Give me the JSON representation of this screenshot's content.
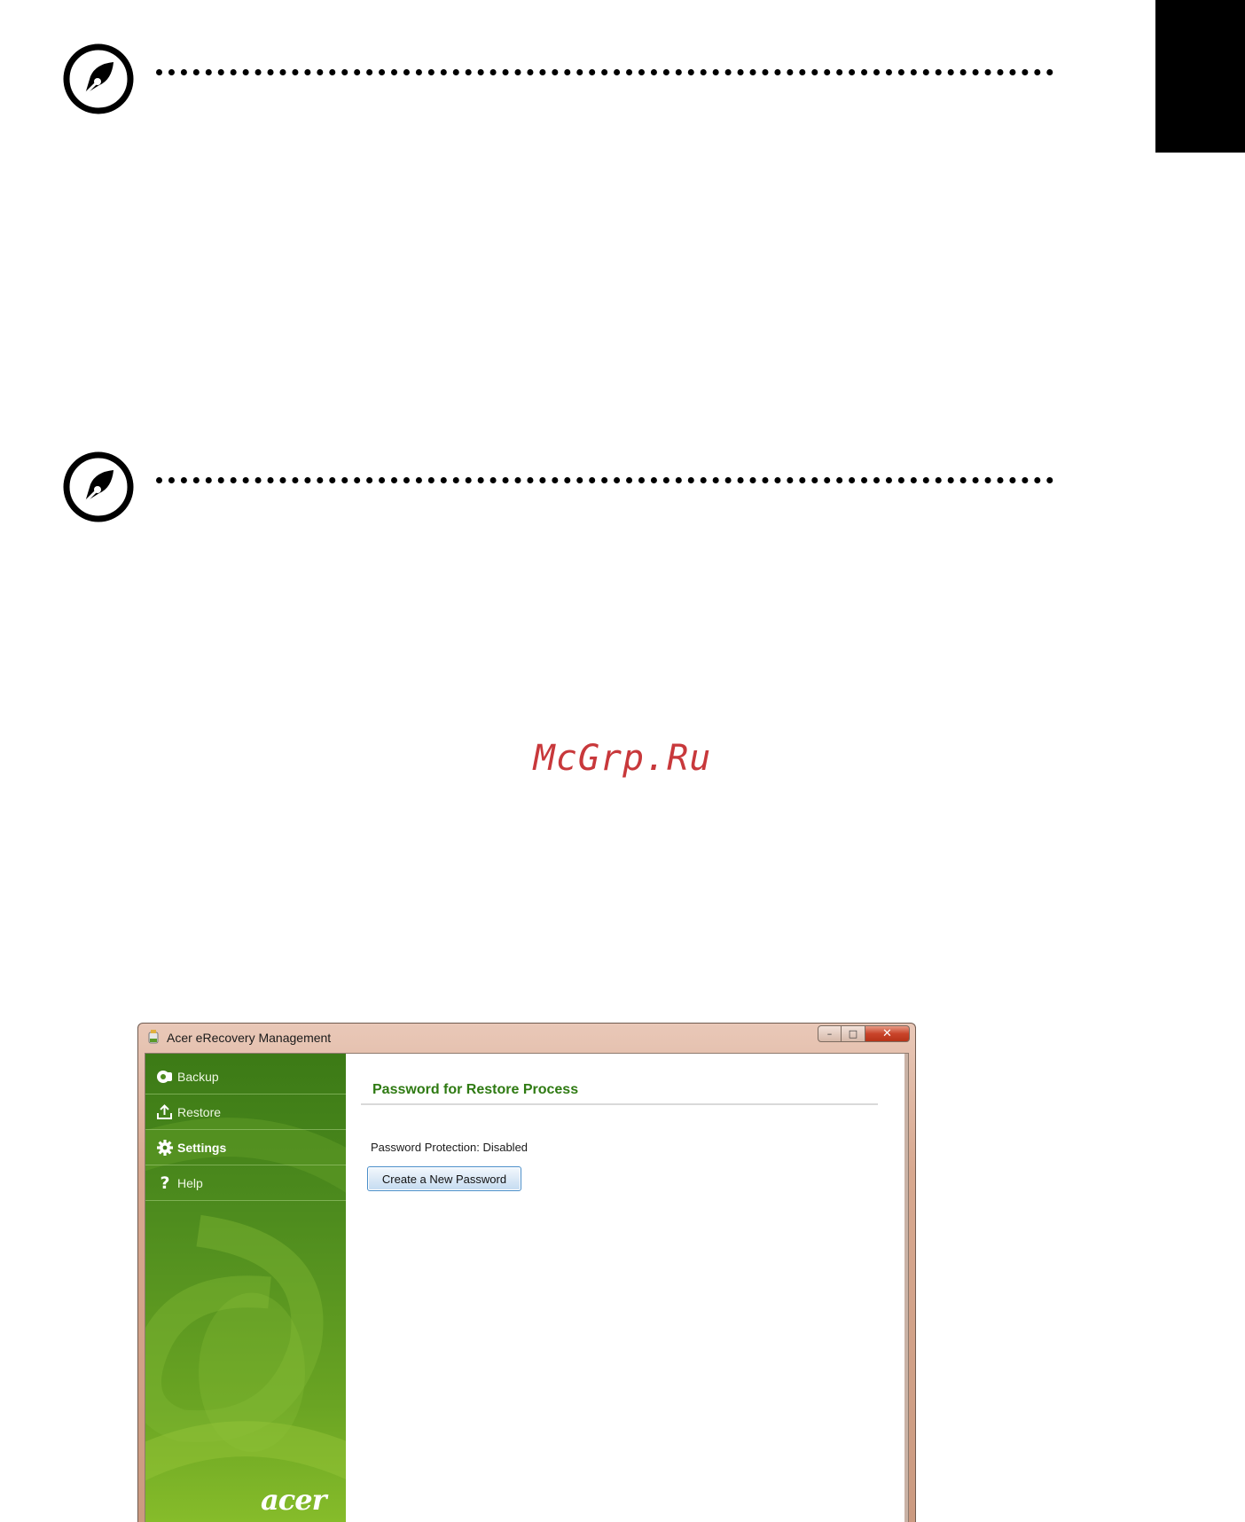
{
  "watermark": "McGrp.Ru",
  "notes": [
    {
      "icon": "note-pen-icon"
    },
    {
      "icon": "note-pen-icon"
    }
  ],
  "window": {
    "title": "Acer eRecovery Management",
    "controls": {
      "minimize": "–",
      "maximize": "□",
      "close": "✕"
    },
    "nav": [
      {
        "label": "Backup",
        "icon": "backup-icon",
        "active": false
      },
      {
        "label": "Restore",
        "icon": "restore-icon",
        "active": false
      },
      {
        "label": "Settings",
        "icon": "gear-icon",
        "active": true
      },
      {
        "label": "Help",
        "icon": "help-icon",
        "active": false
      }
    ],
    "brand": "acer",
    "content": {
      "title": "Password for Restore Process",
      "status": "Password Protection: Disabled",
      "button": "Create a New Password"
    }
  },
  "colors": {
    "watermark": "#c8383b",
    "accent_green": "#2e7a12",
    "sidebar_green": "#4e8c1e"
  }
}
